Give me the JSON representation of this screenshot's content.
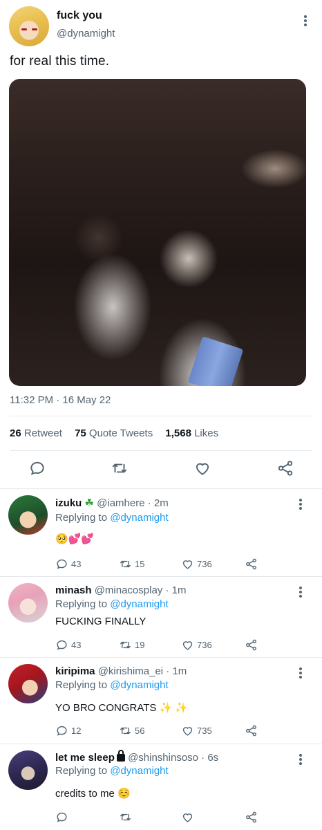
{
  "tweet": {
    "author_name": "fuck you",
    "author_handle": "@dynamight",
    "text": "for real this time.",
    "timestamp": "11:32 PM · 16 May 22",
    "stats": {
      "retweets_count": "26",
      "retweets_label": "Retweet",
      "quotes_count": "75",
      "quotes_label": "Quote Tweets",
      "likes_count": "1,568",
      "likes_label": "Likes"
    },
    "actions": [
      "reply-icon",
      "retweet-icon",
      "like-icon",
      "share-icon"
    ]
  },
  "replies": [
    {
      "name": "izuku",
      "name_suffix": "☘",
      "handle": "@iamhere · 2m",
      "replying_prefix": "Replying to",
      "replying_to": "@dynamight",
      "body": "🥺💕💕",
      "replies": "43",
      "retweets": "15",
      "likes": "736",
      "avatar_colors": [
        "#2b7a3b",
        "#1d4d2a",
        "#f2d2b0"
      ]
    },
    {
      "name": "minash",
      "handle": "@minacosplay · 1m",
      "replying_prefix": "Replying to",
      "replying_to": "@dynamight",
      "body": "FUCKING FINALLY",
      "replies": "43",
      "retweets": "19",
      "likes": "736",
      "avatar_colors": [
        "#f3b3c6",
        "#d9d2d6",
        "#f6e2d8"
      ]
    },
    {
      "name": "kiripima",
      "handle": "@kirishima_ei · 1m",
      "replying_prefix": "Replying to",
      "replying_to": "@dynamight",
      "body": "YO BRO CONGRATS",
      "body_suffix": "✨ ✨",
      "replies": "12",
      "retweets": "56",
      "likes": "735",
      "avatar_colors": [
        "#c8202a",
        "#2a3f7a",
        "#f2d0b4"
      ]
    },
    {
      "name": "let me sleep",
      "handle": "@shinshinsoso · 6s",
      "replying_prefix": "Replying to",
      "replying_to": "@dynamight",
      "body": "credits to me ☺️",
      "replies": "",
      "retweets": "",
      "likes": "",
      "avatar_colors": [
        "#4a3f7a",
        "#1d1b2e",
        "#d9c9b8"
      ]
    }
  ],
  "colors": {
    "link": "#1d9bf0",
    "secondary_text": "#536471",
    "divider": "#e6e9ec"
  }
}
